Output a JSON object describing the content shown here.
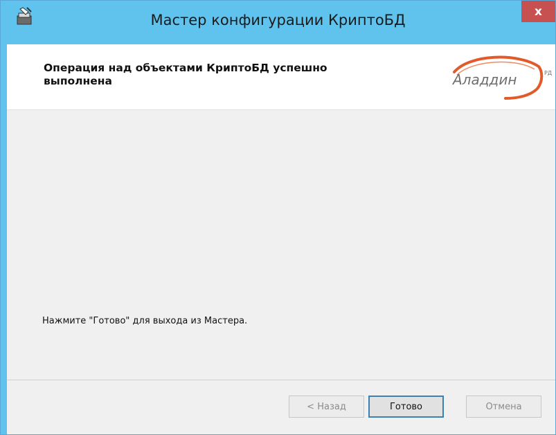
{
  "window": {
    "title": "Мастер конфигурации КриптоБД",
    "close_glyph": "x"
  },
  "header": {
    "title": "Операция над объектами КриптоБД успешно выполнена",
    "logo_text": "Аладдин",
    "logo_suffix": "РД",
    "accent_color": "#e2592a"
  },
  "content": {
    "instruction": "Нажмите \"Готово\" для выхода из Мастера."
  },
  "footer": {
    "back_label": "< Назад",
    "finish_label": "Готово",
    "cancel_label": "Отмена"
  }
}
